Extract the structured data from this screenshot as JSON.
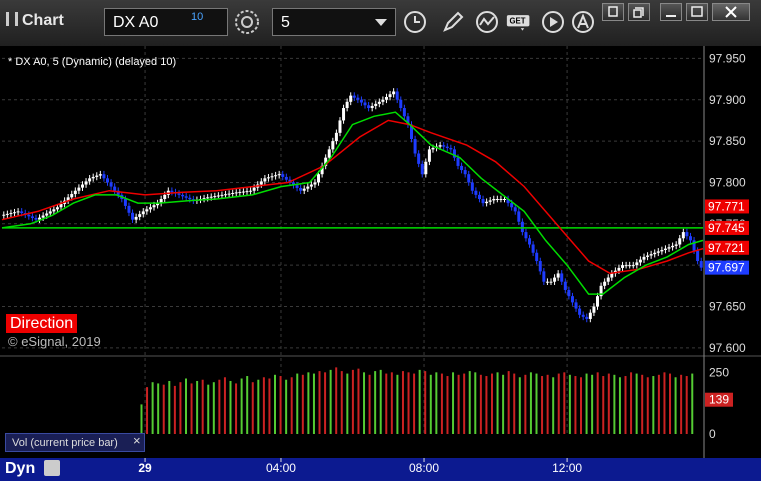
{
  "header": {
    "app_title": "Chart",
    "symbol": "DX A0",
    "symbol_superscript": "10",
    "interval": "5",
    "icons": [
      "pause-icon",
      "settings-gear-icon",
      "dropdown-chevron-icon",
      "clock-icon",
      "pencil-icon",
      "study-icon",
      "get-icon",
      "play-icon",
      "alert-icon",
      "restore-icon",
      "maximize-window-icon",
      "minimize-icon",
      "restore-down-icon",
      "close-icon"
    ]
  },
  "legend_text": "* DX A0, 5 (Dynamic) (delayed 10)",
  "direction_label": "Direction",
  "copyright": "© eSignal, 2019",
  "volume_panel_label": "Vol (current price bar)",
  "volume_close_symbol": "×",
  "bottom_left_label": "Dyn",
  "colors": {
    "background": "#000000",
    "up_candle": "#ffffff",
    "down_candle": "#1e3cff",
    "fast_ma": "#00dd00",
    "slow_ma": "#ee0000",
    "flat_line": "#00dd00",
    "vol_up": "#55cc33",
    "vol_down": "#cc2222",
    "axis_panel": "#0c1a90",
    "gridline": "#3a3a3a"
  },
  "chart_data": [
    {
      "type": "candlestick",
      "title": "",
      "x_ticks": [
        "29",
        "04:00",
        "08:00",
        "12:00"
      ],
      "y_ticks": [
        97.6,
        97.65,
        97.7,
        97.75,
        97.8,
        97.85,
        97.9,
        97.95
      ],
      "ylim": [
        97.595,
        97.965
      ],
      "price_labels": [
        {
          "value": 97.771,
          "text": "97.771",
          "color": "#ee0000"
        },
        {
          "value": 97.745,
          "text": "97.745",
          "color": "#ee0000"
        },
        {
          "value": 97.721,
          "text": "97.721",
          "color": "#ee0000"
        },
        {
          "value": 97.697,
          "text": "97.697",
          "color": "#1e3cff"
        }
      ],
      "series": [
        {
          "kind": "price",
          "points": [
            [
              0,
              97.76
            ],
            [
              5,
              97.765
            ],
            [
              10,
              97.755
            ],
            [
              16,
              97.77
            ],
            [
              21,
              97.79
            ],
            [
              25,
              97.805
            ],
            [
              28,
              97.81
            ],
            [
              31,
              97.795
            ],
            [
              34,
              97.78
            ],
            [
              37,
              97.755
            ],
            [
              40,
              97.765
            ],
            [
              44,
              97.775
            ],
            [
              47,
              97.79
            ],
            [
              50,
              97.785
            ],
            [
              54,
              97.778
            ],
            [
              58,
              97.782
            ],
            [
              62,
              97.785
            ],
            [
              66,
              97.788
            ],
            [
              70,
              97.79
            ],
            [
              74,
              97.805
            ],
            [
              78,
              97.81
            ],
            [
              81,
              97.8
            ],
            [
              84,
              97.79
            ],
            [
              88,
              97.8
            ],
            [
              91,
              97.83
            ],
            [
              94,
              97.86
            ],
            [
              96,
              97.89
            ],
            [
              98,
              97.905
            ],
            [
              100,
              97.9
            ],
            [
              103,
              97.89
            ],
            [
              107,
              97.9
            ],
            [
              110,
              97.91
            ],
            [
              112,
              97.89
            ],
            [
              114,
              97.87
            ],
            [
              116,
              97.835
            ],
            [
              118,
              97.81
            ],
            [
              120,
              97.84
            ],
            [
              123,
              97.845
            ],
            [
              126,
              97.84
            ],
            [
              128,
              97.82
            ],
            [
              130,
              97.81
            ],
            [
              132,
              97.79
            ],
            [
              135,
              97.775
            ],
            [
              138,
              97.78
            ],
            [
              141,
              97.78
            ],
            [
              144,
              97.765
            ],
            [
              146,
              97.74
            ],
            [
              148,
              97.725
            ],
            [
              150,
              97.705
            ],
            [
              152,
              97.68
            ],
            [
              154,
              97.68
            ],
            [
              156,
              97.69
            ],
            [
              158,
              97.67
            ],
            [
              160,
              97.655
            ],
            [
              162,
              97.64
            ],
            [
              164,
              97.635
            ],
            [
              166,
              97.65
            ],
            [
              168,
              97.675
            ],
            [
              171,
              97.69
            ],
            [
              174,
              97.7
            ],
            [
              177,
              97.7
            ],
            [
              180,
              97.71
            ],
            [
              183,
              97.715
            ],
            [
              186,
              97.72
            ],
            [
              189,
              97.725
            ],
            [
              191,
              97.74
            ],
            [
              193,
              97.73
            ],
            [
              195,
              97.705
            ],
            [
              196,
              97.697
            ]
          ]
        },
        {
          "kind": "fast_ma",
          "name": "",
          "points": [
            [
              0,
              97.745
            ],
            [
              8,
              97.75
            ],
            [
              14,
              97.76
            ],
            [
              20,
              97.775
            ],
            [
              26,
              97.785
            ],
            [
              32,
              97.785
            ],
            [
              38,
              97.775
            ],
            [
              44,
              97.775
            ],
            [
              52,
              97.778
            ],
            [
              60,
              97.78
            ],
            [
              70,
              97.785
            ],
            [
              78,
              97.795
            ],
            [
              86,
              97.8
            ],
            [
              92,
              97.83
            ],
            [
              98,
              97.87
            ],
            [
              104,
              97.88
            ],
            [
              110,
              97.885
            ],
            [
              114,
              97.87
            ],
            [
              120,
              97.845
            ],
            [
              128,
              97.83
            ],
            [
              134,
              97.805
            ],
            [
              140,
              97.785
            ],
            [
              146,
              97.765
            ],
            [
              152,
              97.73
            ],
            [
              158,
              97.7
            ],
            [
              164,
              97.665
            ],
            [
              168,
              97.665
            ],
            [
              174,
              97.685
            ],
            [
              180,
              97.7
            ],
            [
              186,
              97.71
            ],
            [
              192,
              97.725
            ],
            [
              196,
              97.73
            ]
          ]
        },
        {
          "kind": "slow_ma",
          "name": "",
          "points": [
            [
              0,
              97.755
            ],
            [
              10,
              97.765
            ],
            [
              20,
              97.78
            ],
            [
              30,
              97.79
            ],
            [
              40,
              97.785
            ],
            [
              50,
              97.788
            ],
            [
              60,
              97.79
            ],
            [
              70,
              97.795
            ],
            [
              80,
              97.8
            ],
            [
              90,
              97.82
            ],
            [
              100,
              97.855
            ],
            [
              108,
              97.875
            ],
            [
              114,
              97.87
            ],
            [
              120,
              97.86
            ],
            [
              130,
              97.845
            ],
            [
              138,
              97.825
            ],
            [
              146,
              97.795
            ],
            [
              152,
              97.765
            ],
            [
              158,
              97.735
            ],
            [
              164,
              97.705
            ],
            [
              170,
              97.69
            ],
            [
              178,
              97.695
            ],
            [
              186,
              97.705
            ],
            [
              192,
              97.715
            ],
            [
              196,
              97.72
            ]
          ]
        },
        {
          "kind": "flat_green",
          "points": [
            [
              0,
              97.745
            ],
            [
              196,
              97.745
            ]
          ]
        },
        {
          "kind": "flat_red",
          "points": [
            [
              0,
              97.745
            ],
            [
              196,
              97.745
            ]
          ]
        }
      ]
    },
    {
      "type": "bar",
      "title": "",
      "y_ticks": [
        0,
        250
      ],
      "ylim": [
        0,
        300
      ],
      "last_value_label": "139",
      "values": [
        120,
        190,
        210,
        205,
        200,
        215,
        195,
        210,
        225,
        205,
        215,
        220,
        200,
        210,
        220,
        230,
        215,
        205,
        225,
        235,
        210,
        220,
        230,
        225,
        240,
        235,
        220,
        230,
        245,
        240,
        250,
        245,
        255,
        250,
        260,
        270,
        255,
        245,
        260,
        265,
        250,
        240,
        255,
        260,
        245,
        250,
        240,
        255,
        250,
        245,
        260,
        255,
        240,
        250,
        245,
        235,
        250,
        240,
        245,
        255,
        250,
        240,
        235,
        245,
        250,
        240,
        255,
        245,
        230,
        240,
        250,
        245,
        235,
        240,
        230,
        245,
        250,
        240,
        235,
        230,
        245,
        240,
        250,
        235,
        245,
        240,
        230,
        235,
        250,
        245,
        240,
        230,
        235,
        240,
        250,
        245,
        230,
        240,
        235,
        245
      ],
      "directions": "uduududdududuudduduududdudududuudduddudduduudduddduduuddudduuddduudduduudduddudduuddduuddudduddduddud"
    }
  ]
}
